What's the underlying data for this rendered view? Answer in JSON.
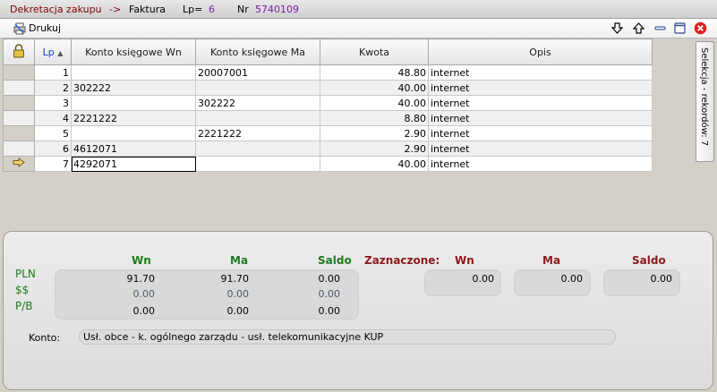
{
  "titlebar": {
    "module": "Dekretacja zakupu",
    "arrow": "->",
    "doc_type": "Faktura",
    "lp_label": "Lp=",
    "lp_value": "6",
    "nr_label": "Nr",
    "nr_value": "5740109"
  },
  "toolbar": {
    "print_label": "Drukuj",
    "icons": [
      "arrow-down-icon",
      "arrow-up-icon",
      "minimize-icon",
      "maximize-icon",
      "close-icon"
    ]
  },
  "grid": {
    "columns": [
      "Lp",
      "Konto księgowe Wn",
      "Konto księgowe Ma",
      "Kwota",
      "Opis"
    ],
    "sort_indicator": "▲",
    "rows": [
      {
        "lp": "1",
        "wn": "",
        "ma": "20007001",
        "kwota": "48.80",
        "opis": "internet"
      },
      {
        "lp": "2",
        "wn": "302222",
        "ma": "",
        "kwota": "40.00",
        "opis": "internet"
      },
      {
        "lp": "3",
        "wn": "",
        "ma": "302222",
        "kwota": "40.00",
        "opis": "internet"
      },
      {
        "lp": "4",
        "wn": "2221222",
        "ma": "",
        "kwota": "8.80",
        "opis": "internet"
      },
      {
        "lp": "5",
        "wn": "",
        "ma": "2221222",
        "kwota": "2.90",
        "opis": "internet"
      },
      {
        "lp": "6",
        "wn": "4612071",
        "ma": "",
        "kwota": "2.90",
        "opis": "internet"
      },
      {
        "lp": "7",
        "wn": "4292071",
        "ma": "",
        "kwota": "40.00",
        "opis": "internet"
      }
    ],
    "current_row": 7
  },
  "side_tab": {
    "label": "Selekcja - rekordów: 7"
  },
  "summary": {
    "headers": {
      "wn": "Wn",
      "ma": "Ma",
      "saldo": "Saldo"
    },
    "row_labels": [
      "PLN",
      "$$",
      "P/B"
    ],
    "pln": {
      "wn": "91.70",
      "ma": "91.70",
      "saldo": "0.00"
    },
    "usd": {
      "wn": "0.00",
      "ma": "0.00",
      "saldo": "0.00"
    },
    "pb": {
      "wn": "0.00",
      "ma": "0.00",
      "saldo": "0.00"
    },
    "selected": {
      "label": "Zaznaczone:",
      "wn_label": "Wn",
      "ma_label": "Ma",
      "saldo_label": "Saldo",
      "wn": "0.00",
      "ma": "0.00",
      "saldo": "0.00"
    },
    "konto_label": "Konto:",
    "konto_value": "Usł. obce - k. ogólnego zarządu - usł. telekomunikacyjne KUP"
  }
}
